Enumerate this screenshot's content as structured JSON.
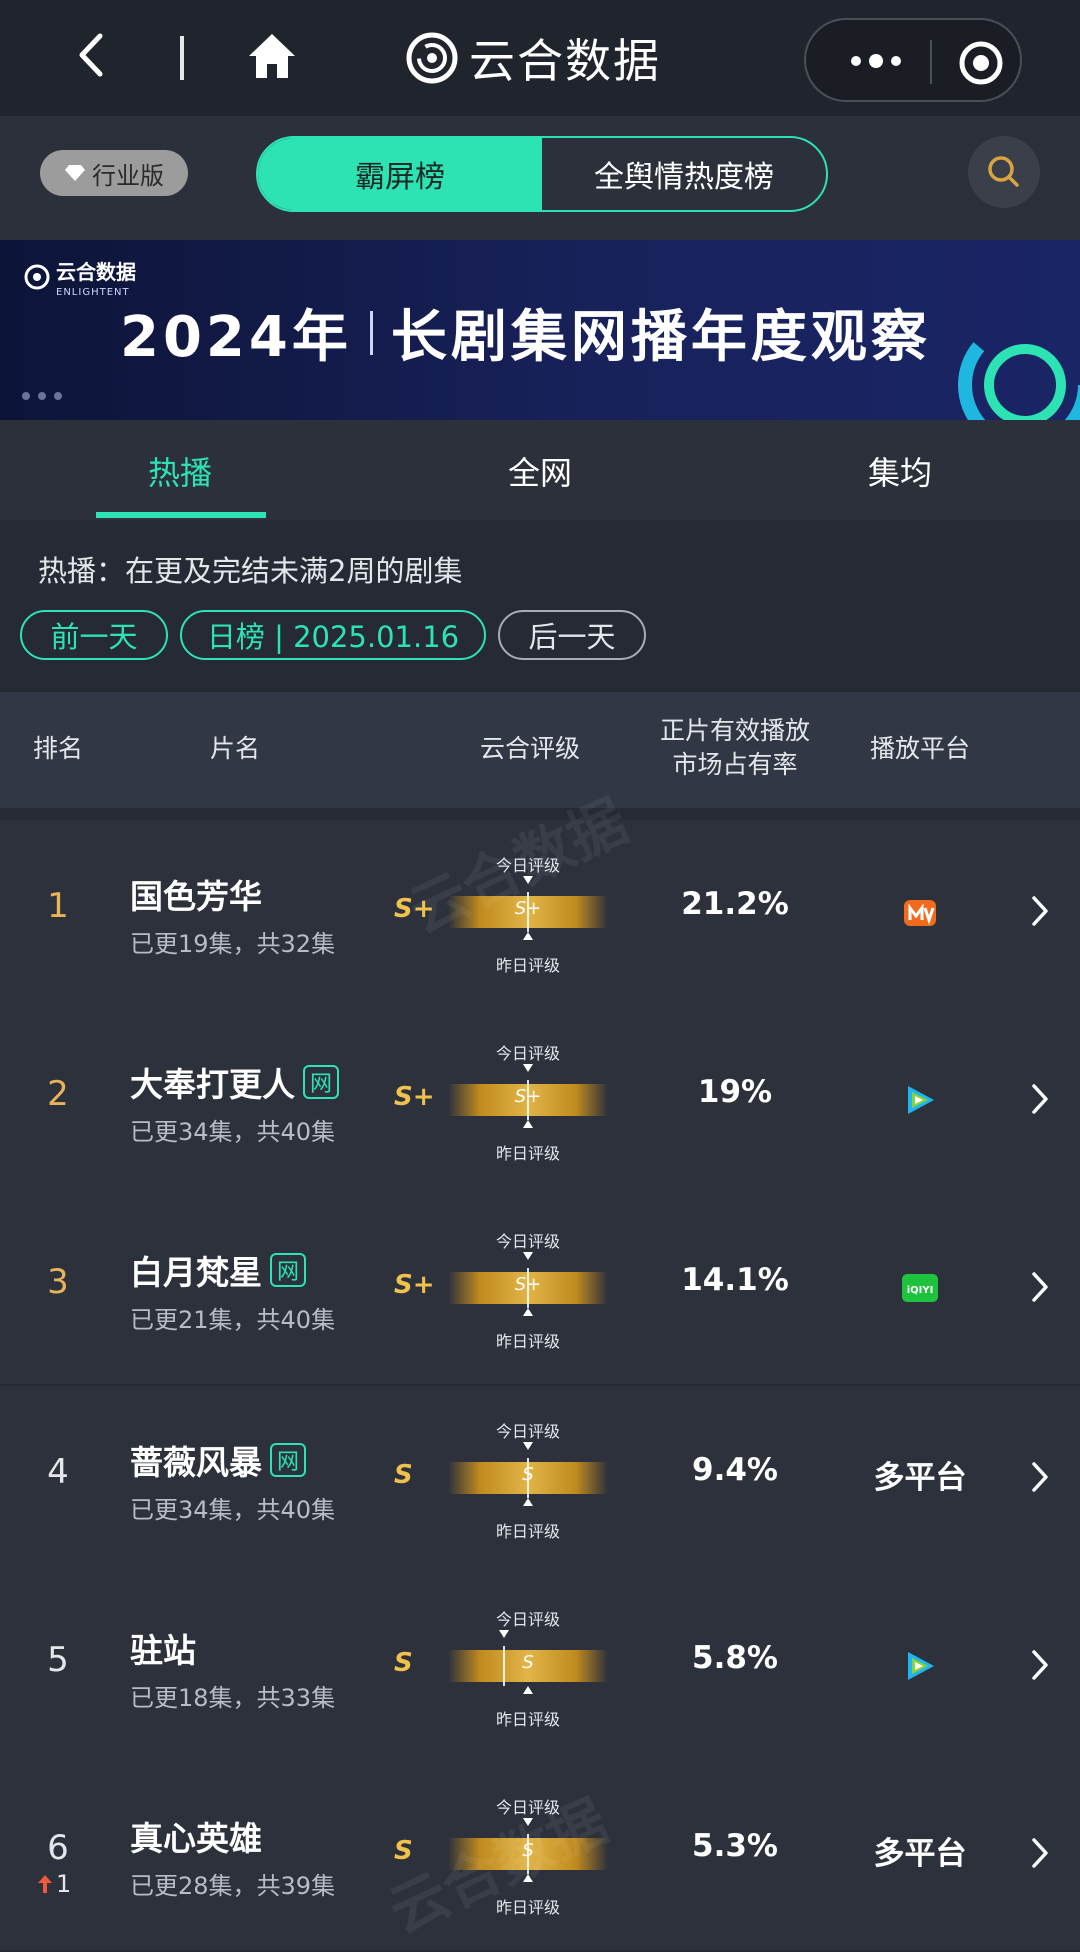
{
  "navbar": {
    "app_title": "云合数据"
  },
  "header": {
    "industry_badge": "行业版",
    "segments": [
      "霸屏榜",
      "全舆情热度榜"
    ]
  },
  "banner": {
    "logo_cn": "云合数据",
    "logo_en": "ENLIGHTENT",
    "title_year": "2024年",
    "title_main": "长剧集网播年度观察"
  },
  "tabs": [
    "热播",
    "全网",
    "集均"
  ],
  "description": "热播：在更及完结未满2周的剧集",
  "date_nav": {
    "prev": "前一天",
    "current": "日榜 | 2025.01.16",
    "next": "后一天"
  },
  "table_header": {
    "rank": "排名",
    "name": "片名",
    "grade": "云合评级",
    "share_line1": "正片有效播放",
    "share_line2": "市场占有率",
    "platform": "播放平台"
  },
  "grade_labels": {
    "today": "今日评级",
    "yesterday": "昨日评级"
  },
  "rows": [
    {
      "rank": "1",
      "title": "国色芳华",
      "net": "",
      "episodes": "已更19集，共32集",
      "grade": "S+",
      "share": "21.2%",
      "platform": "",
      "platform_icon": "mango-tv-icon",
      "rank_change": ""
    },
    {
      "rank": "2",
      "title": "大奉打更人",
      "net": "网",
      "episodes": "已更34集，共40集",
      "grade": "S+",
      "share": "19%",
      "platform": "",
      "platform_icon": "tencent-video-icon",
      "rank_change": ""
    },
    {
      "rank": "3",
      "title": "白月梵星",
      "net": "网",
      "episodes": "已更21集，共40集",
      "grade": "S+",
      "share": "14.1%",
      "platform": "",
      "platform_icon": "iqiyi-icon",
      "rank_change": ""
    },
    {
      "rank": "4",
      "title": "蔷薇风暴",
      "net": "网",
      "episodes": "已更34集，共40集",
      "grade": "S",
      "share": "9.4%",
      "platform": "多平台",
      "platform_icon": "",
      "rank_change": ""
    },
    {
      "rank": "5",
      "title": "驻站",
      "net": "",
      "episodes": "已更18集，共33集",
      "grade": "S",
      "share": "5.8%",
      "platform": "",
      "platform_icon": "tencent-video-icon",
      "rank_change": ""
    },
    {
      "rank": "6",
      "title": "真心英雄",
      "net": "",
      "episodes": "已更28集，共39集",
      "grade": "S",
      "share": "5.3%",
      "platform": "多平台",
      "platform_icon": "",
      "rank_change": "1"
    }
  ],
  "colors": {
    "accent": "#2de3b3",
    "gold": "#f0c24b",
    "rank_top": "#e8b45a",
    "up_arrow": "#f05a3a"
  }
}
